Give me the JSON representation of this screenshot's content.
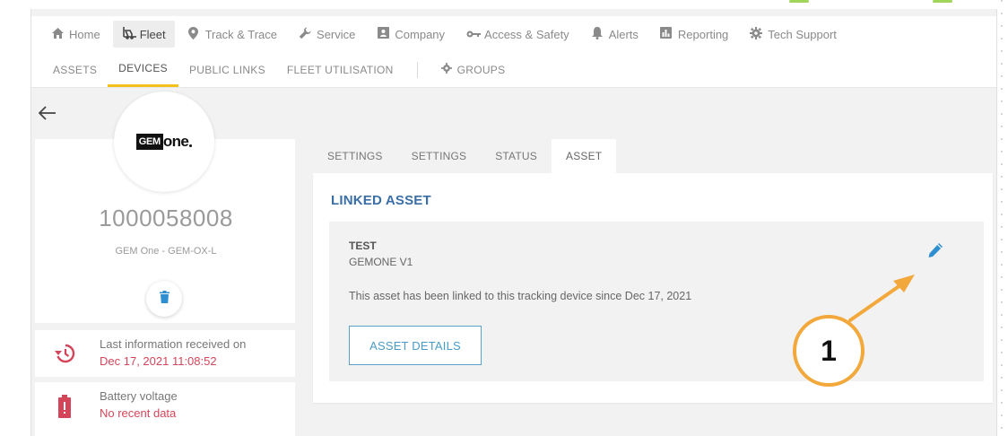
{
  "topnav": {
    "items": [
      {
        "label": "Home",
        "icon": "home-icon"
      },
      {
        "label": "Fleet",
        "icon": "forklift-icon",
        "active": true
      },
      {
        "label": "Track & Trace",
        "icon": "location-pin-icon"
      },
      {
        "label": "Service",
        "icon": "wrench-icon"
      },
      {
        "label": "Company",
        "icon": "id-card-icon"
      },
      {
        "label": "Access & Safety",
        "icon": "key-icon"
      },
      {
        "label": "Alerts",
        "icon": "bell-icon"
      },
      {
        "label": "Reporting",
        "icon": "chart-icon"
      },
      {
        "label": "Tech Support",
        "icon": "gear-icon"
      }
    ]
  },
  "subnav": {
    "items": [
      "ASSETS",
      "DEVICES",
      "PUBLIC LINKS",
      "FLEET UTILISATION"
    ],
    "active": "DEVICES",
    "groups_label": "GROUPS"
  },
  "device": {
    "logo_gem": "GEM",
    "logo_one": "one",
    "id": "1000058008",
    "model": "GEM One - GEM-OX-L"
  },
  "info": {
    "last_info_label": "Last information received on",
    "last_info_value": "Dec 17, 2021 11:08:52",
    "battery_label": "Battery voltage",
    "battery_value": "No recent data"
  },
  "tabs": [
    "SETTINGS",
    "SETTINGS",
    "STATUS",
    "ASSET"
  ],
  "active_tab": "ASSET",
  "linked_asset": {
    "title": "LINKED ASSET",
    "name": "TEST",
    "type": "GEMONE V1",
    "description": "This asset has been linked to this tracking device since Dec 17, 2021",
    "details_button": "ASSET DETAILS"
  },
  "callout": {
    "number": "1"
  },
  "colors": {
    "accent_yellow": "#f2c21b",
    "link_blue": "#3a6ea5",
    "button_blue": "#4a9bc6",
    "alert_red": "#d4455a",
    "annotation_orange": "#f2a83b"
  }
}
